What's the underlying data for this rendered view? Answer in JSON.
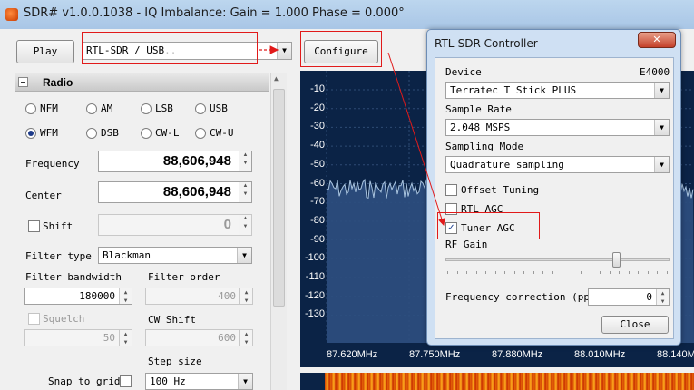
{
  "window": {
    "title": "SDR# v1.0.0.1038 - IQ Imbalance: Gain = 1.000 Phase = 0.000°"
  },
  "toolbar": {
    "play_label": "Play",
    "source": "RTL-SDR / USB",
    "configure_label": "Configure"
  },
  "radio": {
    "header": "Radio",
    "modes": [
      "NFM",
      "AM",
      "LSB",
      "USB",
      "WFM",
      "DSB",
      "CW-L",
      "CW-U"
    ],
    "selected_mode": "WFM",
    "frequency_label": "Frequency",
    "frequency": "88,606,948",
    "center_label": "Center",
    "center": "88,606,948",
    "shift_label": "Shift",
    "shift": "0",
    "filter_type_label": "Filter type",
    "filter_type": "Blackman",
    "filter_bandwidth_label": "Filter bandwidth",
    "filter_bandwidth": "180000",
    "filter_order_label": "Filter order",
    "filter_order": "400",
    "squelch_label": "Squelch",
    "squelch": "50",
    "cw_shift_label": "CW Shift",
    "cw_shift": "600",
    "step_size_label": "Step size",
    "snap_label": "Snap to grid",
    "step_size": "100 Hz"
  },
  "spectrum": {
    "db_labels": [
      "-10",
      "-20",
      "-30",
      "-40",
      "-50",
      "-60",
      "-70",
      "-80",
      "-90",
      "-100",
      "-110",
      "-120",
      "-130"
    ],
    "freq_labels": [
      "87.620MHz",
      "87.750MHz",
      "87.880MHz",
      "88.010MHz",
      "88.140MHz"
    ]
  },
  "dialog": {
    "title": "RTL-SDR Controller",
    "device_label": "Device",
    "device_tuner": "E4000",
    "device": "Terratec T Stick PLUS",
    "sample_rate_label": "Sample Rate",
    "sample_rate": "2.048 MSPS",
    "sampling_mode_label": "Sampling Mode",
    "sampling_mode": "Quadrature sampling",
    "offset_tuning_label": "Offset Tuning",
    "rtl_agc_label": "RTL AGC",
    "tuner_agc_label": "Tuner AGC",
    "rf_gain_label": "RF Gain",
    "freq_corr_label": "Frequency correction (ppm)",
    "freq_corr": "0",
    "close_label": "Close"
  },
  "icons": {
    "close": "close-icon",
    "collapse": "minus-icon",
    "checkmark": "✓",
    "spin": "▲▼"
  },
  "colors": {
    "annotation": "#e11a1a",
    "spectrum_bg": "#0b2346",
    "spectrum_trace": "#a9c4df"
  }
}
